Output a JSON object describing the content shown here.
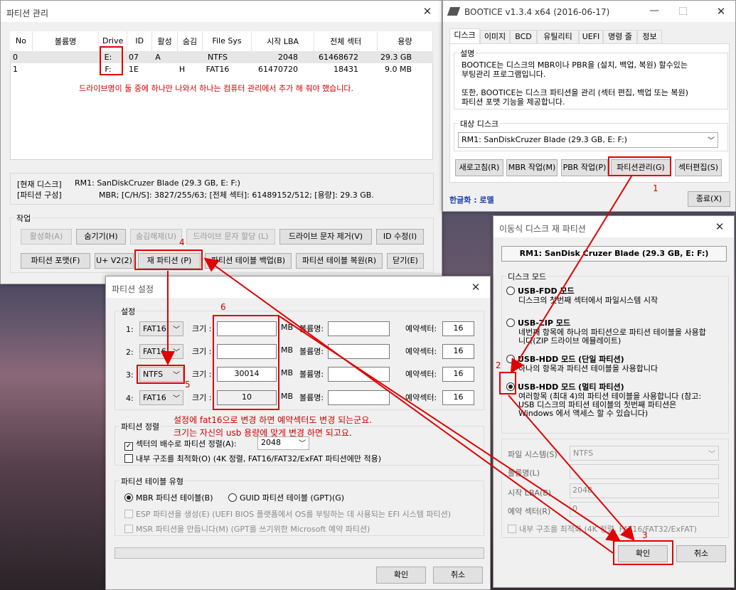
{
  "partition_window": {
    "title": "파티션 관리",
    "columns": [
      "No",
      "볼륨명",
      "Drive",
      "ID",
      "활성",
      "숨김",
      "File Sys",
      "시작 LBA",
      "전체 섹터",
      "용량"
    ],
    "rows": [
      [
        "0",
        "",
        "E:",
        "07",
        "A",
        "",
        "NTFS",
        "2048",
        "61468672",
        "29.3 GB"
      ],
      [
        "1",
        "",
        "F:",
        "1E",
        "",
        "H",
        "FAT16",
        "61470720",
        "18431",
        "9.0 MB"
      ]
    ],
    "note": "드라이브명이 둘 중에 하나만 나와서 하나는 컴퓨터 관리에서 추가 해 줘야 했습니다.",
    "current_disk_label": "[현재 디스크]",
    "current_disk_value": "RM1: SanDiskCruzer Blade (29.3 GB, E: F:)",
    "partition_layout_label": "[파티션 구성]",
    "partition_layout_value": "MBR;    [C/H/S]: 3827/255/63; [전체 섹터]: 61489152/512; [용량]: 29.3 GB.",
    "task_group": "작업",
    "buttons": {
      "activate": "활성화(A)",
      "hide": "숨기기(H)",
      "unhide": "숨김해제(U)",
      "assign_letter": "드라이브 문자 할당 (L)",
      "remove_letter": "드라이브 문자 제거(V)",
      "modify_id": "ID 수정(I)",
      "format": "파티션 포맷(F)",
      "uv2": "U+ V2(2)",
      "repartition": "재 파티션 (P)",
      "backup": "파티션 테이블 백업(B)",
      "restore": "파티션 테이블 복원(R)",
      "close": "닫기(E)"
    }
  },
  "bootice": {
    "title": "BOOTICE v1.3.4 x64 (2016-06-17)",
    "tabs": [
      "디스크",
      "이미지",
      "BCD",
      "유틸리티",
      "UEFI",
      "명령 줄",
      "정보"
    ],
    "desc_label": "설명",
    "desc1": "BOOTICE는 디스크의 MBR이나 PBR을 (설치, 백업, 복원) 할수있는",
    "desc2": "부팅관리 프로그램입니다.",
    "desc3": "또한, BOOTICE는 디스크 파티션을 관리 (섹터 편집, 백업 또는 복원)",
    "desc4": "파티션 포맷 기능을 제공합니다.",
    "target_label": "대상 디스크",
    "target_value": "RM1: SanDiskCruzer Blade (29.3 GB, E: F:)",
    "buttons": {
      "refresh": "새로고침(R)",
      "mbr": "MBR 작업(M)",
      "pbr": "PBR 작업(P)",
      "partmgmt": "파티션관리(G)",
      "sector": "섹터편집(S)",
      "exit": "종료(X)"
    },
    "localized": "한글화 : 로멜"
  },
  "removable_dialog": {
    "title": "이동식 디스크 재 파티션",
    "disk": "RM1: SanDisk Cruzer Blade (29.3 GB, E: F:)",
    "mode_group": "디스크 모드",
    "modes": [
      {
        "label": "USB-FDD 모드",
        "desc": "디스크의 첫번째 섹터에서 파일시스템 시작"
      },
      {
        "label": "USB-ZIP 모드",
        "desc": "네번째 항목에 하나의 파티션으로 파티션 테이블을 사용합니다(ZIP 드라이브 에뮬레이트)"
      },
      {
        "label": "USB-HDD 모드 (단일 파티션)",
        "desc": "하나의 항목과 파티션 테이블을 사용합니다"
      },
      {
        "label": "USB-HDD 모드 (멀티 파티션)",
        "desc": "여러항목 (최대 4)의 파티션 테이블을 사용합니다 (참고: USB 디스크의 파티션 테이블의 첫번째 파티션은 Windows 에서 액세스 할 수 있습니다)"
      }
    ],
    "fs_label": "파일 시스템(S)",
    "fs_value": "NTFS",
    "vol_label": "볼륨명(L)",
    "lba_label": "시작 LBA(B)",
    "lba_value": "2048",
    "reserved_label": "예약 섹터(R)",
    "reserved_value": "0",
    "optimize": "내부 구조를 최적화 (4K 정렬, FAT16/FAT32/ExFAT)",
    "ok": "확인",
    "cancel": "취소"
  },
  "settings_dialog": {
    "title": "파티션 설정",
    "group": "설정",
    "size_label": "크기 :",
    "mb": "MB",
    "vol_label": "볼륨명:",
    "reserved_label": "예약섹터:",
    "rows": [
      {
        "num": "1:",
        "fs": "FAT16",
        "size": "",
        "reserved": "16"
      },
      {
        "num": "2:",
        "fs": "FAT16",
        "size": "",
        "reserved": "16"
      },
      {
        "num": "3:",
        "fs": "NTFS",
        "size": "30014",
        "reserved": "16"
      },
      {
        "num": "4:",
        "fs": "FAT16",
        "size": "10",
        "reserved": "16"
      }
    ],
    "note1": "설정에 fat16으로 변경 하면 예약섹터도 변경 되는군요.",
    "note2": "크기는 자신의 usb 용량에 맞게 변경 하면 되고요.",
    "align_group": "파티션 정렬",
    "align_label": "섹터의 배수로 파티션 정렬(A):",
    "align_value": "2048",
    "optimize": "내부 구조를 최적화(O) (4K 정렬, FAT16/FAT32/ExFAT 파티션에만 적용)",
    "table_group": "파티션 테이블 유형",
    "mbr": "MBR 파티션 테이블(B)",
    "gpt": "GUID 파티션 테이블 (GPT)(G)",
    "esp": "ESP 파티션을 생성(E) (UEFI BIOS 플랫폼에서 OS를 부팅하는 데 사용되는 EFI 시스템 파티션)",
    "msr": "MSR 파티션을 만듭니다(M) (GPT를 쓰기위한 Microsoft 예약 파티션)",
    "ok": "확인",
    "cancel": "취소"
  },
  "steps": [
    "1",
    "2",
    "3",
    "4",
    "5",
    "6"
  ],
  "colors": {
    "annotation": "#e00000",
    "window_bg": "#f0f0f0"
  }
}
